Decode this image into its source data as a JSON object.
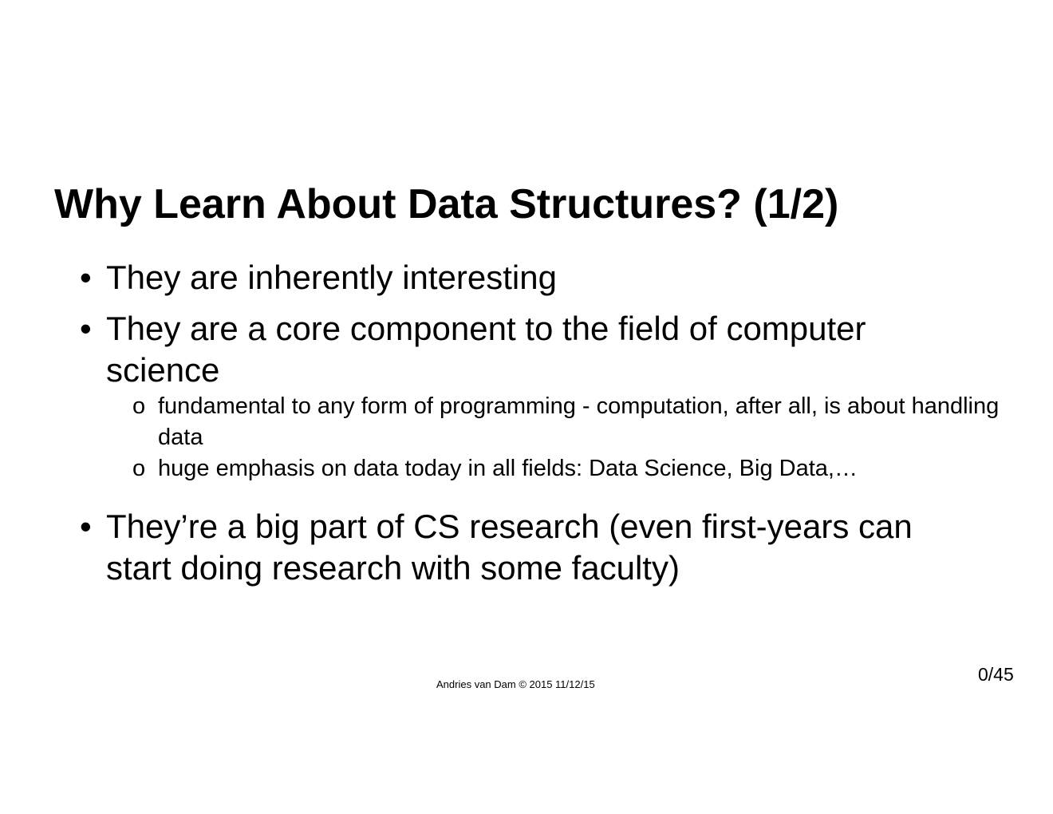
{
  "slide": {
    "title": "Why Learn About Data Structures? (1/2)",
    "bullet_marker": "•",
    "subbullet_marker": "o",
    "bullets": [
      {
        "text": "They are inherently interesting"
      },
      {
        "text": "They are a core component to the field of computer science",
        "subbullets": [
          "fundamental to any form of programming - computation, after all, is about handling data",
          "huge emphasis on data today in all fields:  Data Science, Big Data,…"
        ]
      },
      {
        "text": "They’re a big part of CS research (even first-years can start doing research with some faculty)"
      }
    ],
    "footer": "Andries van Dam © 2015 11/12/15",
    "page_number": "0/45"
  }
}
